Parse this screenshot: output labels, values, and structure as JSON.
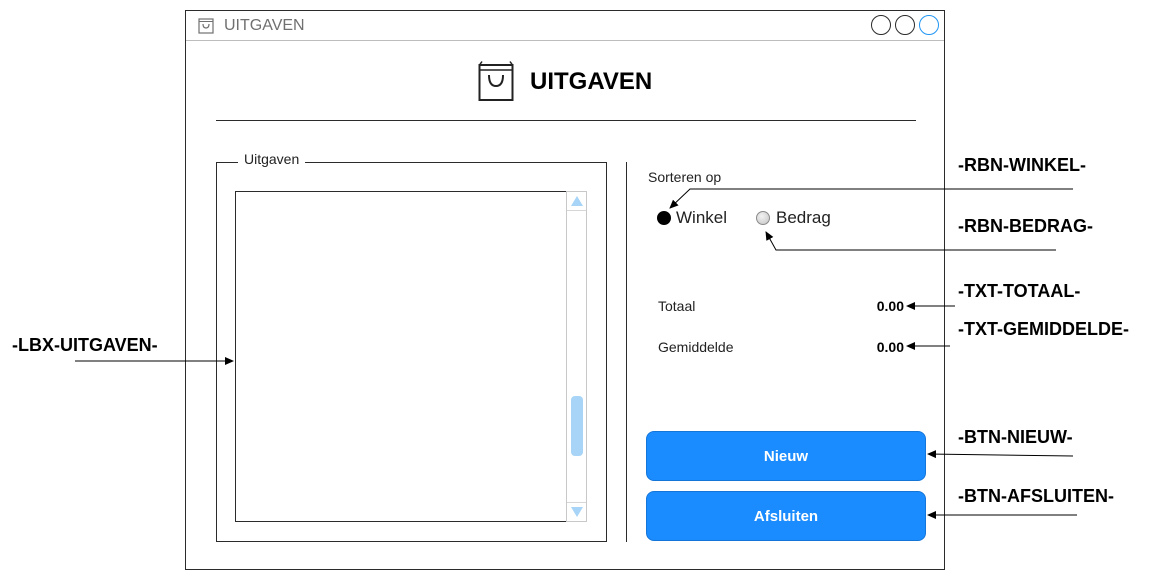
{
  "window": {
    "title": "UITGAVEN",
    "header_title": "UITGAVEN",
    "icons": [
      "shopping-bag-icon",
      "minimize-icon",
      "maximize-icon",
      "close-icon"
    ]
  },
  "group": {
    "legend": "Uitgaven",
    "listbox_items": []
  },
  "sort": {
    "label": "Sorteren op",
    "options": [
      {
        "label": "Winkel",
        "selected": true
      },
      {
        "label": "Bedrag",
        "selected": false
      }
    ]
  },
  "stats": {
    "totaal_label": "Totaal",
    "totaal_value": "0.00",
    "gemiddelde_label": "Gemiddelde",
    "gemiddelde_value": "0.00"
  },
  "buttons": {
    "nieuw": "Nieuw",
    "afsluiten": "Afsluiten"
  },
  "annotations": {
    "rbn_winkel": "-RBN-WINKEL-",
    "rbn_bedrag": "-RBN-BEDRAG-",
    "txt_totaal": "-TXT-TOTAAL-",
    "txt_gemiddelde": "-TXT-GEMIDDELDE-",
    "lbx_uitgaven": "-LBX-UITGAVEN-",
    "btn_nieuw": "-BTN-NIEUW-",
    "btn_afsluiten": "-BTN-AFSLUITEN-"
  },
  "colors": {
    "accent": "#1a8cff",
    "scroll": "#a7d4f7",
    "close_button": "#2196f3"
  }
}
